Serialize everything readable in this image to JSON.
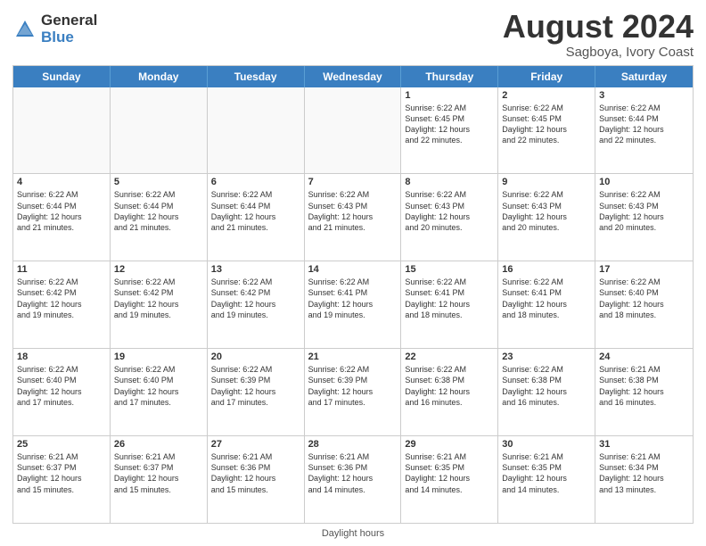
{
  "logo": {
    "general": "General",
    "blue": "Blue"
  },
  "title": {
    "month_year": "August 2024",
    "location": "Sagboya, Ivory Coast"
  },
  "header_days": [
    "Sunday",
    "Monday",
    "Tuesday",
    "Wednesday",
    "Thursday",
    "Friday",
    "Saturday"
  ],
  "footer": "Daylight hours",
  "weeks": [
    [
      {
        "day": "",
        "info": "",
        "empty": true
      },
      {
        "day": "",
        "info": "",
        "empty": true
      },
      {
        "day": "",
        "info": "",
        "empty": true
      },
      {
        "day": "",
        "info": "",
        "empty": true
      },
      {
        "day": "1",
        "info": "Sunrise: 6:22 AM\nSunset: 6:45 PM\nDaylight: 12 hours\nand 22 minutes.",
        "empty": false
      },
      {
        "day": "2",
        "info": "Sunrise: 6:22 AM\nSunset: 6:45 PM\nDaylight: 12 hours\nand 22 minutes.",
        "empty": false
      },
      {
        "day": "3",
        "info": "Sunrise: 6:22 AM\nSunset: 6:44 PM\nDaylight: 12 hours\nand 22 minutes.",
        "empty": false
      }
    ],
    [
      {
        "day": "4",
        "info": "Sunrise: 6:22 AM\nSunset: 6:44 PM\nDaylight: 12 hours\nand 21 minutes.",
        "empty": false
      },
      {
        "day": "5",
        "info": "Sunrise: 6:22 AM\nSunset: 6:44 PM\nDaylight: 12 hours\nand 21 minutes.",
        "empty": false
      },
      {
        "day": "6",
        "info": "Sunrise: 6:22 AM\nSunset: 6:44 PM\nDaylight: 12 hours\nand 21 minutes.",
        "empty": false
      },
      {
        "day": "7",
        "info": "Sunrise: 6:22 AM\nSunset: 6:43 PM\nDaylight: 12 hours\nand 21 minutes.",
        "empty": false
      },
      {
        "day": "8",
        "info": "Sunrise: 6:22 AM\nSunset: 6:43 PM\nDaylight: 12 hours\nand 20 minutes.",
        "empty": false
      },
      {
        "day": "9",
        "info": "Sunrise: 6:22 AM\nSunset: 6:43 PM\nDaylight: 12 hours\nand 20 minutes.",
        "empty": false
      },
      {
        "day": "10",
        "info": "Sunrise: 6:22 AM\nSunset: 6:43 PM\nDaylight: 12 hours\nand 20 minutes.",
        "empty": false
      }
    ],
    [
      {
        "day": "11",
        "info": "Sunrise: 6:22 AM\nSunset: 6:42 PM\nDaylight: 12 hours\nand 19 minutes.",
        "empty": false
      },
      {
        "day": "12",
        "info": "Sunrise: 6:22 AM\nSunset: 6:42 PM\nDaylight: 12 hours\nand 19 minutes.",
        "empty": false
      },
      {
        "day": "13",
        "info": "Sunrise: 6:22 AM\nSunset: 6:42 PM\nDaylight: 12 hours\nand 19 minutes.",
        "empty": false
      },
      {
        "day": "14",
        "info": "Sunrise: 6:22 AM\nSunset: 6:41 PM\nDaylight: 12 hours\nand 19 minutes.",
        "empty": false
      },
      {
        "day": "15",
        "info": "Sunrise: 6:22 AM\nSunset: 6:41 PM\nDaylight: 12 hours\nand 18 minutes.",
        "empty": false
      },
      {
        "day": "16",
        "info": "Sunrise: 6:22 AM\nSunset: 6:41 PM\nDaylight: 12 hours\nand 18 minutes.",
        "empty": false
      },
      {
        "day": "17",
        "info": "Sunrise: 6:22 AM\nSunset: 6:40 PM\nDaylight: 12 hours\nand 18 minutes.",
        "empty": false
      }
    ],
    [
      {
        "day": "18",
        "info": "Sunrise: 6:22 AM\nSunset: 6:40 PM\nDaylight: 12 hours\nand 17 minutes.",
        "empty": false
      },
      {
        "day": "19",
        "info": "Sunrise: 6:22 AM\nSunset: 6:40 PM\nDaylight: 12 hours\nand 17 minutes.",
        "empty": false
      },
      {
        "day": "20",
        "info": "Sunrise: 6:22 AM\nSunset: 6:39 PM\nDaylight: 12 hours\nand 17 minutes.",
        "empty": false
      },
      {
        "day": "21",
        "info": "Sunrise: 6:22 AM\nSunset: 6:39 PM\nDaylight: 12 hours\nand 17 minutes.",
        "empty": false
      },
      {
        "day": "22",
        "info": "Sunrise: 6:22 AM\nSunset: 6:38 PM\nDaylight: 12 hours\nand 16 minutes.",
        "empty": false
      },
      {
        "day": "23",
        "info": "Sunrise: 6:22 AM\nSunset: 6:38 PM\nDaylight: 12 hours\nand 16 minutes.",
        "empty": false
      },
      {
        "day": "24",
        "info": "Sunrise: 6:21 AM\nSunset: 6:38 PM\nDaylight: 12 hours\nand 16 minutes.",
        "empty": false
      }
    ],
    [
      {
        "day": "25",
        "info": "Sunrise: 6:21 AM\nSunset: 6:37 PM\nDaylight: 12 hours\nand 15 minutes.",
        "empty": false
      },
      {
        "day": "26",
        "info": "Sunrise: 6:21 AM\nSunset: 6:37 PM\nDaylight: 12 hours\nand 15 minutes.",
        "empty": false
      },
      {
        "day": "27",
        "info": "Sunrise: 6:21 AM\nSunset: 6:36 PM\nDaylight: 12 hours\nand 15 minutes.",
        "empty": false
      },
      {
        "day": "28",
        "info": "Sunrise: 6:21 AM\nSunset: 6:36 PM\nDaylight: 12 hours\nand 14 minutes.",
        "empty": false
      },
      {
        "day": "29",
        "info": "Sunrise: 6:21 AM\nSunset: 6:35 PM\nDaylight: 12 hours\nand 14 minutes.",
        "empty": false
      },
      {
        "day": "30",
        "info": "Sunrise: 6:21 AM\nSunset: 6:35 PM\nDaylight: 12 hours\nand 14 minutes.",
        "empty": false
      },
      {
        "day": "31",
        "info": "Sunrise: 6:21 AM\nSunset: 6:34 PM\nDaylight: 12 hours\nand 13 minutes.",
        "empty": false
      }
    ]
  ]
}
